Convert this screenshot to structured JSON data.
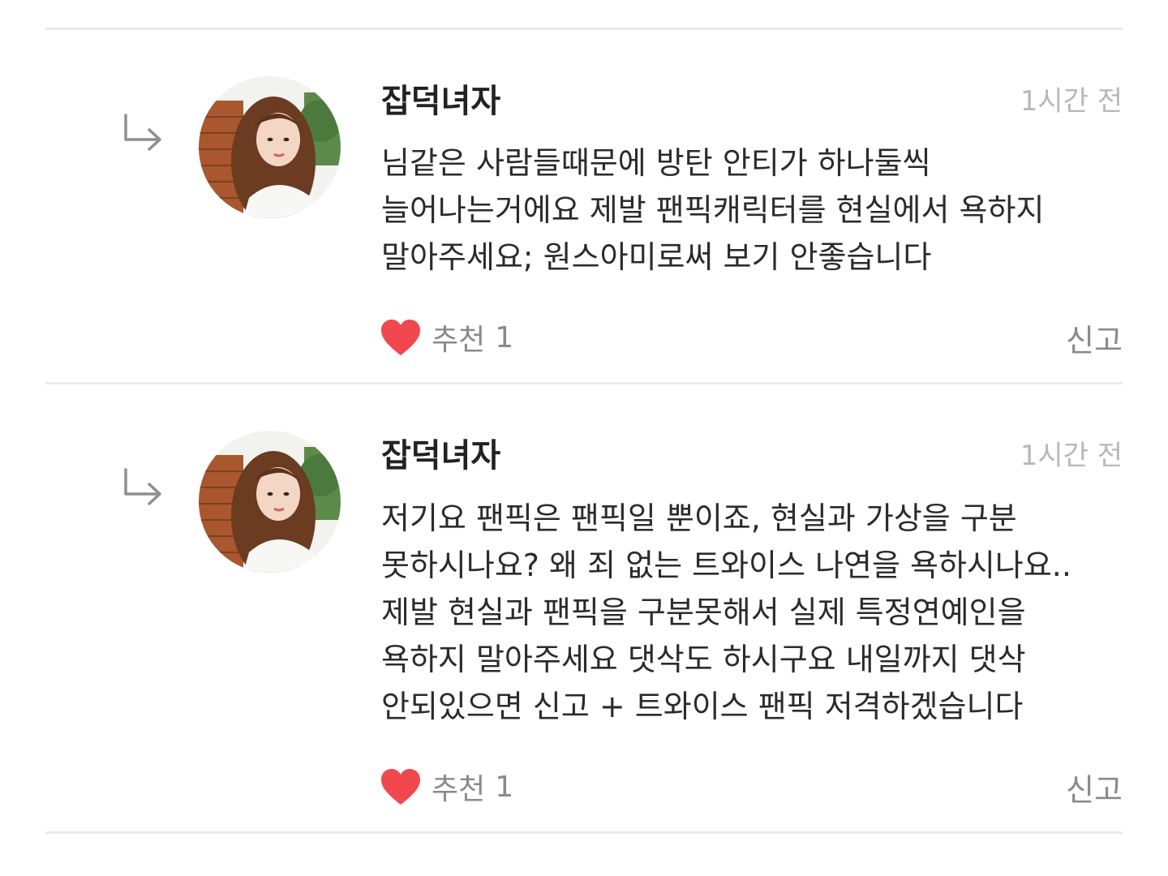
{
  "comments": [
    {
      "author": "잡덕녀자",
      "time": "1시간 전",
      "lines": [
        "님같은 사람들때문에 방탄 안티가 하나둘씩",
        "늘어나는거에요 제발 팬픽캐릭터를 현실에서 욕하지",
        "말아주세요; 원스아미로써 보기 안좋습니다"
      ],
      "like_label": "추천",
      "like_count": "1",
      "report_label": "신고"
    },
    {
      "author": "잡덕녀자",
      "time": "1시간 전",
      "lines": [
        "저기요 팬픽은 팬픽일 뿐이죠, 현실과 가상을 구분",
        "못하시나요? 왜 죄 없는 트와이스 나연을 욕하시나요..",
        "제발 현실과 팬픽을 구분못해서 실제 특정연예인을",
        "욕하지 말아주세요 댓삭도 하시구요 내일까지 댓삭",
        "안되있으면 신고 + 트와이스 팬픽 저격하겠습니다"
      ],
      "like_label": "추천",
      "like_count": "1",
      "report_label": "신고"
    }
  ],
  "colors": {
    "heart": "#f0484d",
    "divider": "#ebebeb",
    "text": "#2b2b2b",
    "muted": "#8a8a8a",
    "timestamp": "#b8b8b8"
  },
  "icons": {
    "reply": "reply-arrow-icon",
    "like": "heart-icon"
  }
}
